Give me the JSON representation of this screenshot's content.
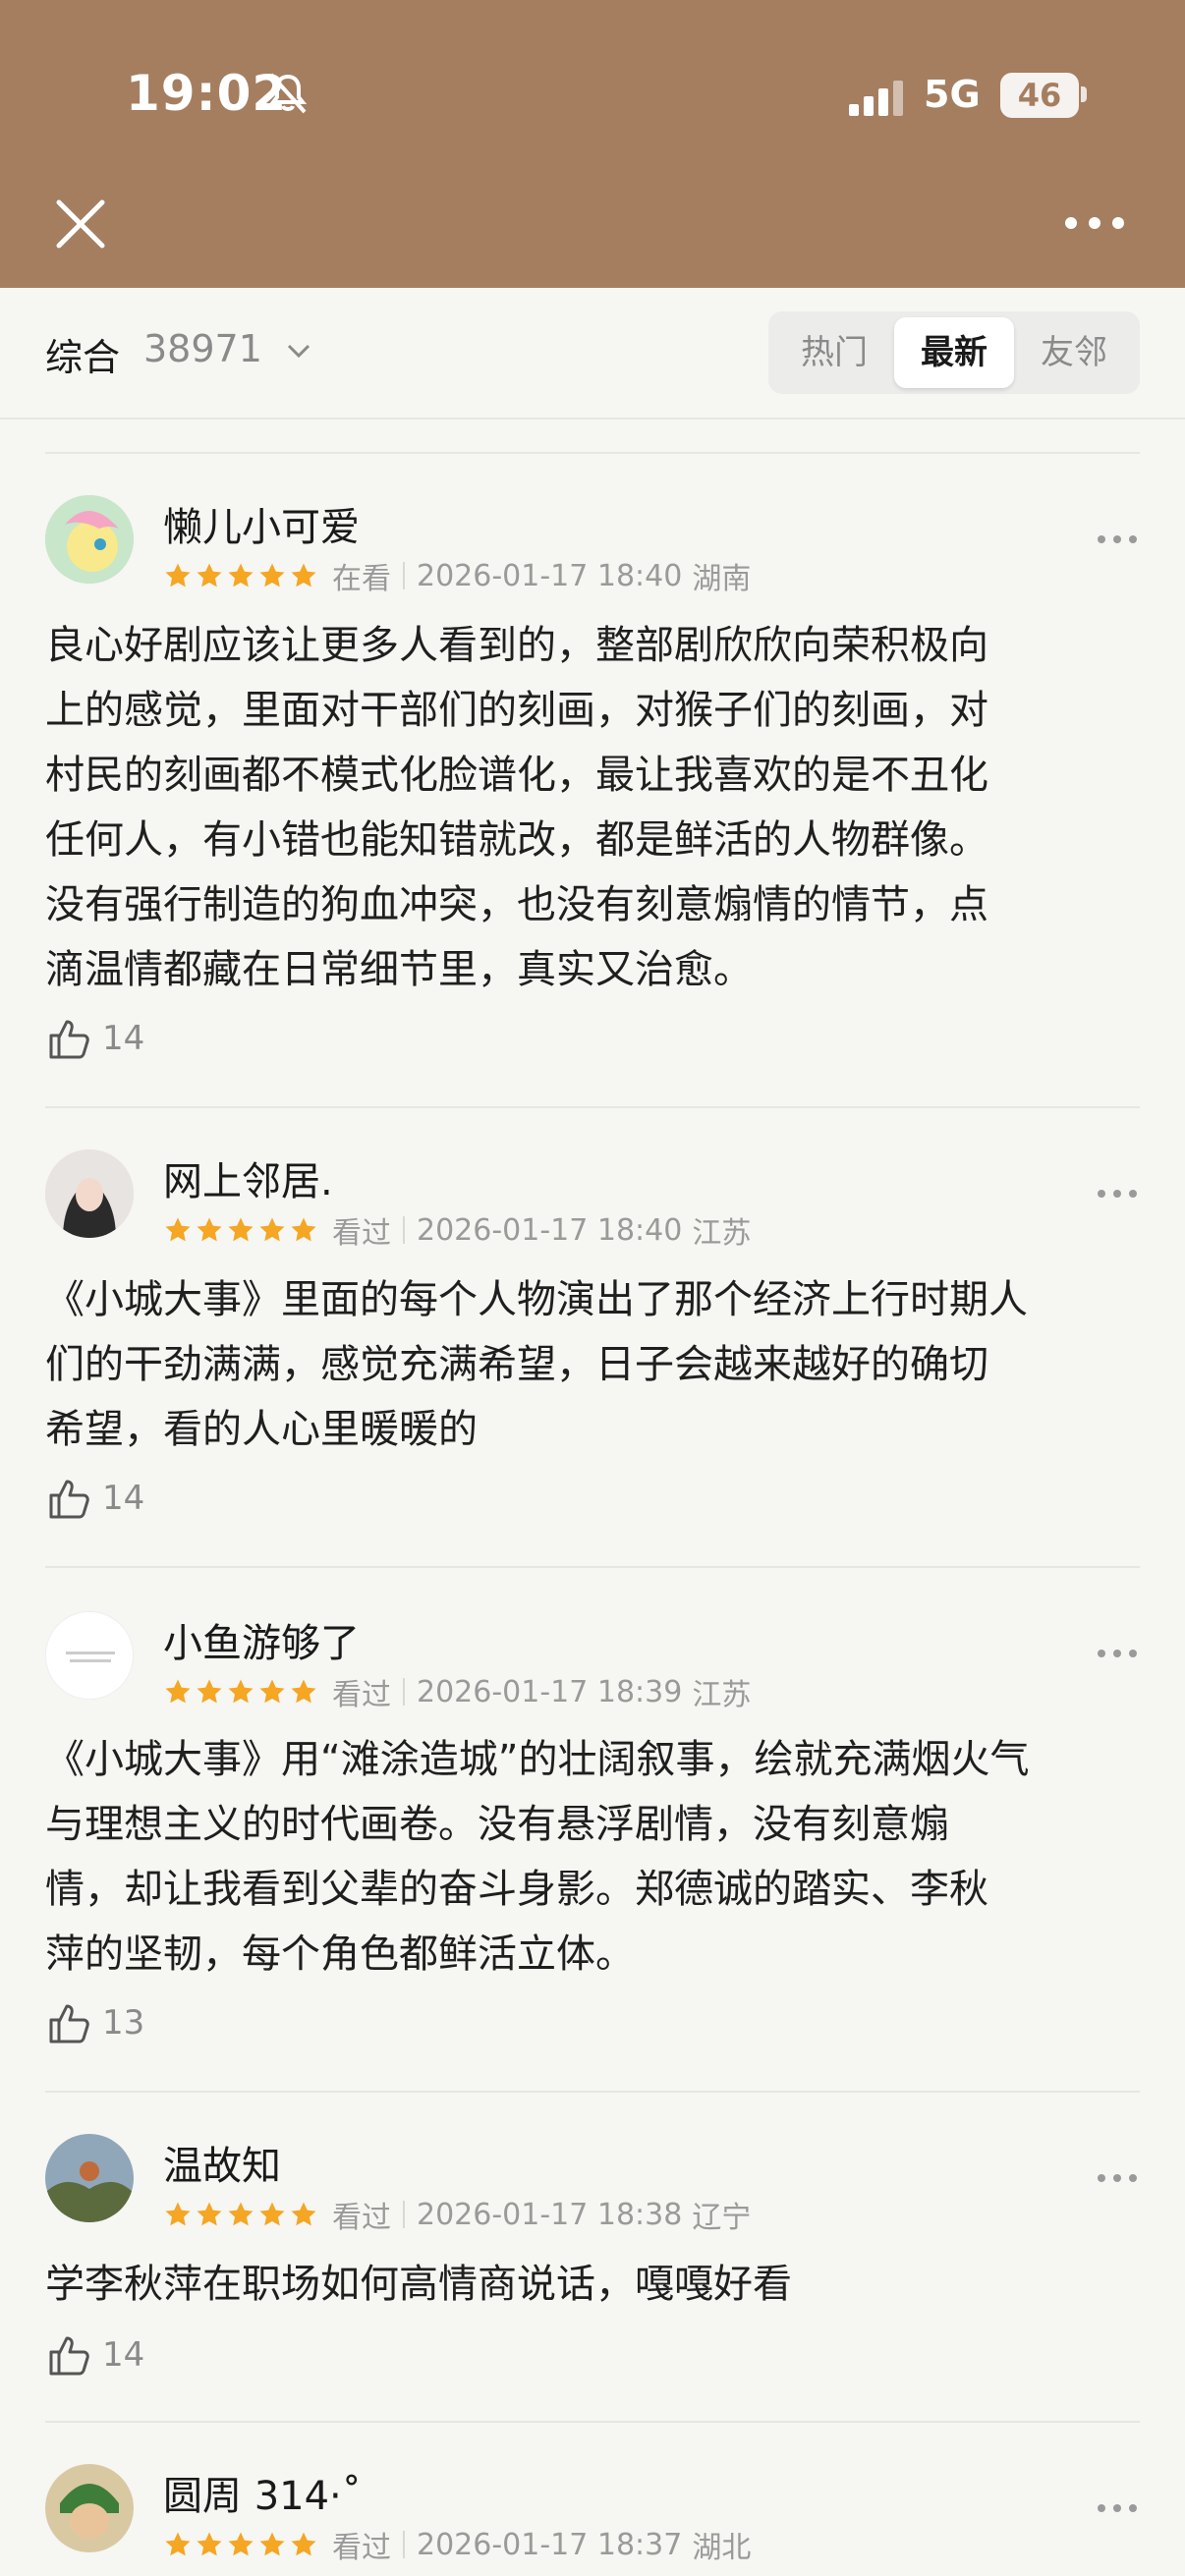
{
  "status_bar": {
    "time": "19:02",
    "network": "5G",
    "battery": "46"
  },
  "header": {
    "close_icon": "close-icon",
    "more_icon": "more-horizontal-icon"
  },
  "filter": {
    "sort_label": "综合",
    "count": "38971",
    "tabs": [
      {
        "label": "热门",
        "active": false
      },
      {
        "label": "最新",
        "active": true
      },
      {
        "label": "友邻",
        "active": false
      }
    ]
  },
  "colors": {
    "header_bg": "#a57e60",
    "star": "#f5a623",
    "page_bg": "#f6f6f3"
  },
  "reviews": [
    {
      "name": "懒儿小可爱",
      "rating": 5,
      "status": "在看",
      "date": "2026-01-17 18:40",
      "location": "湖南",
      "text": "良心好剧应该让更多人看到的，整部剧欣欣向荣积极向\n上的感觉，里面对干部们的刻画，对猴子们的刻画，对\n村民的刻画都不模式化脸谱化，最让我喜欢的是不丑化\n任何人，有小错也能知错就改，都是鲜活的人物群像。\n没有强行制造的狗血冲突，也没有刻意煽情的情节，点\n滴温情都藏在日常细节里，真实又治愈。",
      "likes": "14"
    },
    {
      "name": "网上邻居.",
      "rating": 5,
      "status": "看过",
      "date": "2026-01-17 18:40",
      "location": "江苏",
      "text": "《小城大事》里面的每个人物演出了那个经济上行时期人\n们的干劲满满，感觉充满希望，日子会越来越好的确切\n希望，看的人心里暖暖的",
      "likes": "14"
    },
    {
      "name": "小鱼游够了",
      "rating": 5,
      "status": "看过",
      "date": "2026-01-17 18:39",
      "location": "江苏",
      "text": "《小城大事》用“滩涂造城”的壮阔叙事，绘就充满烟火气\n与理想主义的时代画卷。没有悬浮剧情，没有刻意煽\n情，却让我看到父辈的奋斗身影。郑德诚的踏实、李秋\n萍的坚韧，每个角色都鲜活立体。",
      "likes": "13"
    },
    {
      "name": "温故知",
      "rating": 5,
      "status": "看过",
      "date": "2026-01-17 18:38",
      "location": "辽宁",
      "text": "学李秋萍在职场如何高情商说话，嘎嘎好看",
      "likes": "14"
    },
    {
      "name": "圆周 314·˚",
      "rating": 5,
      "status": "看过",
      "date": "2026-01-17 18:37",
      "location": "湖北",
      "text": "",
      "likes": ""
    }
  ]
}
